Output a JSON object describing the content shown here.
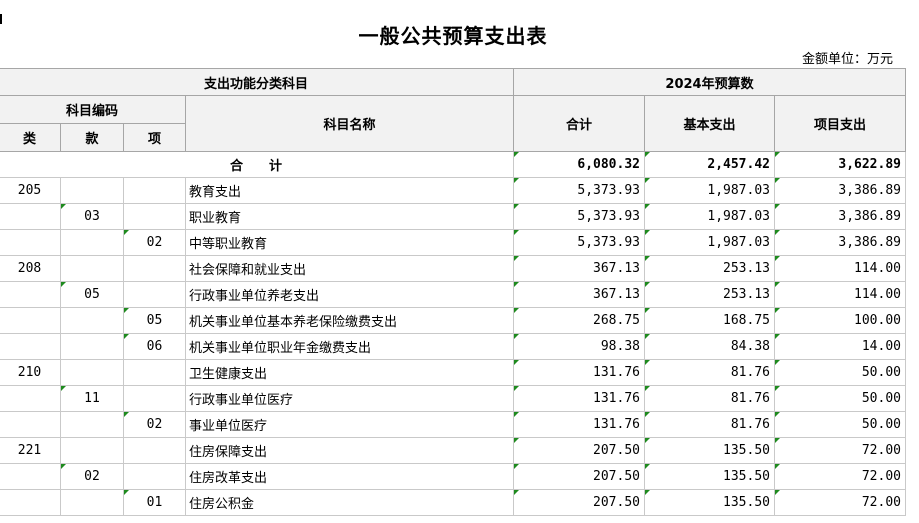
{
  "title": "一般公共预算支出表",
  "unit": "金额单位：万元",
  "headers": {
    "category_group": "支出功能分类科目",
    "budget_group": "2024年预算数",
    "code_group": "科目编码",
    "lei": "类",
    "kuan": "款",
    "xiang": "项",
    "name": "科目名称",
    "total": "合计",
    "basic": "基本支出",
    "project": "项目支出"
  },
  "total_row": {
    "label": "合　　计",
    "total": "6,080.32",
    "basic": "2,457.42",
    "project": "3,622.89"
  },
  "rows": [
    {
      "lei": "205",
      "kuan": "",
      "xiang": "",
      "name": "教育支出",
      "total": "5,373.93",
      "basic": "1,987.03",
      "project": "3,386.89"
    },
    {
      "lei": "",
      "kuan": "03",
      "xiang": "",
      "name": "职业教育",
      "total": "5,373.93",
      "basic": "1,987.03",
      "project": "3,386.89"
    },
    {
      "lei": "",
      "kuan": "",
      "xiang": "02",
      "name": "中等职业教育",
      "total": "5,373.93",
      "basic": "1,987.03",
      "project": "3,386.89"
    },
    {
      "lei": "208",
      "kuan": "",
      "xiang": "",
      "name": "社会保障和就业支出",
      "total": "367.13",
      "basic": "253.13",
      "project": "114.00"
    },
    {
      "lei": "",
      "kuan": "05",
      "xiang": "",
      "name": "行政事业单位养老支出",
      "total": "367.13",
      "basic": "253.13",
      "project": "114.00"
    },
    {
      "lei": "",
      "kuan": "",
      "xiang": "05",
      "name": "机关事业单位基本养老保险缴费支出",
      "total": "268.75",
      "basic": "168.75",
      "project": "100.00"
    },
    {
      "lei": "",
      "kuan": "",
      "xiang": "06",
      "name": "机关事业单位职业年金缴费支出",
      "total": "98.38",
      "basic": "84.38",
      "project": "14.00"
    },
    {
      "lei": "210",
      "kuan": "",
      "xiang": "",
      "name": "卫生健康支出",
      "total": "131.76",
      "basic": "81.76",
      "project": "50.00"
    },
    {
      "lei": "",
      "kuan": "11",
      "xiang": "",
      "name": "行政事业单位医疗",
      "total": "131.76",
      "basic": "81.76",
      "project": "50.00"
    },
    {
      "lei": "",
      "kuan": "",
      "xiang": "02",
      "name": "事业单位医疗",
      "total": "131.76",
      "basic": "81.76",
      "project": "50.00"
    },
    {
      "lei": "221",
      "kuan": "",
      "xiang": "",
      "name": "住房保障支出",
      "total": "207.50",
      "basic": "135.50",
      "project": "72.00"
    },
    {
      "lei": "",
      "kuan": "02",
      "xiang": "",
      "name": "住房改革支出",
      "total": "207.50",
      "basic": "135.50",
      "project": "72.00"
    },
    {
      "lei": "",
      "kuan": "",
      "xiang": "01",
      "name": "住房公积金",
      "total": "207.50",
      "basic": "135.50",
      "project": "72.00"
    }
  ]
}
